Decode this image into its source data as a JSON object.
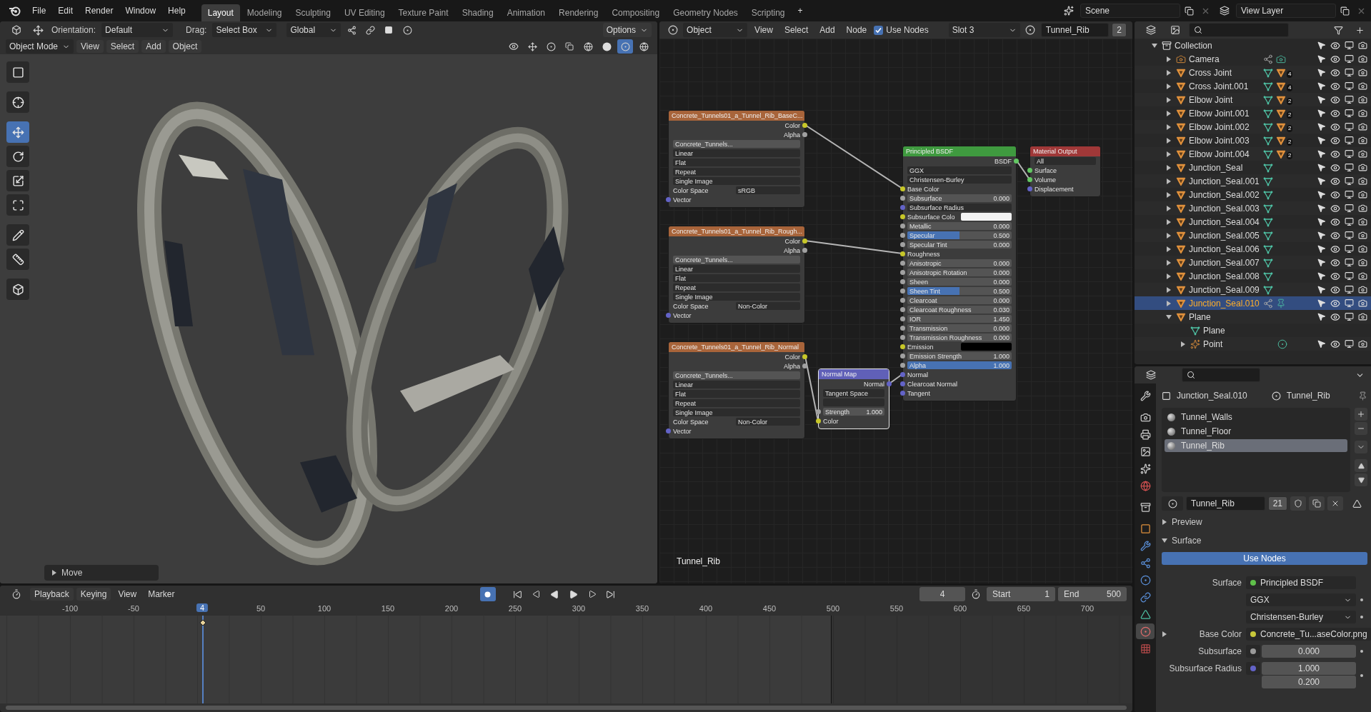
{
  "menu": [
    "File",
    "Edit",
    "Render",
    "Window",
    "Help"
  ],
  "workspaces": [
    {
      "label": "Layout",
      "selected": true
    },
    {
      "label": "Modeling",
      "selected": false
    },
    {
      "label": "Sculpting",
      "selected": false
    },
    {
      "label": "UV Editing",
      "selected": false
    },
    {
      "label": "Texture Paint",
      "selected": false
    },
    {
      "label": "Shading",
      "selected": false
    },
    {
      "label": "Animation",
      "selected": false
    },
    {
      "label": "Rendering",
      "selected": false
    },
    {
      "label": "Compositing",
      "selected": false
    },
    {
      "label": "Geometry Nodes",
      "selected": false
    },
    {
      "label": "Scripting",
      "selected": false
    }
  ],
  "add_workspace": "+",
  "scene": "Scene",
  "view_layer": "View Layer",
  "viewport": {
    "orientation_label": "Orientation:",
    "orientation": "Default",
    "drag_label": "Drag:",
    "drag": "Select Box",
    "transform": "Global",
    "options": "Options",
    "mode": "Object Mode",
    "menus": [
      "View",
      "Select",
      "Add",
      "Object"
    ],
    "tools": [
      {
        "kind": "select",
        "selected": false
      },
      {
        "kind": "cursor",
        "selected": false
      },
      {
        "kind": "move",
        "selected": true
      },
      {
        "kind": "rotate",
        "selected": false
      },
      {
        "kind": "scale",
        "selected": false
      },
      {
        "kind": "transform",
        "selected": false
      },
      {
        "kind": "annotate",
        "selected": false
      },
      {
        "kind": "measure",
        "selected": false
      },
      {
        "kind": "add-cube",
        "selected": false
      }
    ],
    "last_operator": "Move"
  },
  "node_editor": {
    "type": "Object",
    "menus": [
      "View",
      "Select",
      "Add",
      "Node"
    ],
    "use_nodes": {
      "label": "Use Nodes",
      "checked": true
    },
    "slot": "Slot 3",
    "material": "Tunnel_Rib",
    "users": "2",
    "material_label": "Tunnel_Rib",
    "nodes": [
      {
        "title": "Concrete_Tunnels01_a_Tunnel_Rib_BaseC...",
        "outputs": [
          "Color",
          "Alpha"
        ],
        "image": "Concrete_Tunnels...",
        "options": [
          "Linear",
          "Flat",
          "Repeat",
          "Single Image"
        ],
        "color_space_label": "Color Space",
        "color_space": "sRGB",
        "input": "Vector"
      },
      {
        "title": "Concrete_Tunnels01_a_Tunnel_Rib_Rough...",
        "outputs": [
          "Color",
          "Alpha"
        ],
        "image": "Concrete_Tunnels...",
        "options": [
          "Linear",
          "Flat",
          "Repeat",
          "Single Image"
        ],
        "color_space_label": "Color Space",
        "color_space": "Non-Color",
        "input": "Vector"
      },
      {
        "title": "Concrete_Tunnels01_a_Tunnel_Rib_Normal",
        "outputs": [
          "Color",
          "Alpha"
        ],
        "image": "Concrete_Tunnels...",
        "options": [
          "Linear",
          "Flat",
          "Repeat",
          "Single Image"
        ],
        "color_space_label": "Color Space",
        "color_space": "Non-Color",
        "input": "Vector"
      },
      {
        "kind": "normal_map",
        "title": "Normal Map",
        "output": "Normal",
        "space": "Tangent Space",
        "strength_label": "Strength",
        "strength": "1.000",
        "input": "Color"
      },
      {
        "kind": "principled",
        "title": "Principled BSDF",
        "output": "BSDF",
        "dropdowns": [
          "GGX",
          "Christensen-Burley"
        ],
        "inputs": [
          {
            "label": "Base Color",
            "kind": "socket"
          },
          {
            "label": "Subsurface",
            "kind": "value",
            "value": "0.000"
          },
          {
            "label": "Subsurface Radius",
            "kind": "dropdown"
          },
          {
            "label": "Subsurface Colo",
            "kind": "swatch",
            "color": "#f2f2f2"
          },
          {
            "label": "Metallic",
            "kind": "value",
            "value": "0.000"
          },
          {
            "label": "Specular",
            "kind": "slider",
            "value": "0.500",
            "level": 0.5
          },
          {
            "label": "Specular Tint",
            "kind": "value",
            "value": "0.000"
          },
          {
            "label": "Roughness",
            "kind": "socket"
          },
          {
            "label": "Anisotropic",
            "kind": "value",
            "value": "0.000"
          },
          {
            "label": "Anisotropic Rotation",
            "kind": "value",
            "value": "0.000"
          },
          {
            "label": "Sheen",
            "kind": "value",
            "value": "0.000"
          },
          {
            "label": "Sheen Tint",
            "kind": "slider",
            "value": "0.500",
            "level": 0.5
          },
          {
            "label": "Clearcoat",
            "kind": "value",
            "value": "0.000"
          },
          {
            "label": "Clearcoat Roughness",
            "kind": "value",
            "value": "0.030"
          },
          {
            "label": "IOR",
            "kind": "value",
            "value": "1.450"
          },
          {
            "label": "Transmission",
            "kind": "value",
            "value": "0.000"
          },
          {
            "label": "Transmission Roughness",
            "kind": "value",
            "value": "0.000"
          },
          {
            "label": "Emission",
            "kind": "swatch",
            "color": "#000000"
          },
          {
            "label": "Emission Strength",
            "kind": "value",
            "value": "1.000"
          },
          {
            "label": "Alpha",
            "kind": "slider",
            "value": "1.000",
            "level": 1
          },
          {
            "label": "Normal",
            "kind": "vector"
          },
          {
            "label": "Clearcoat Normal",
            "kind": "vector"
          },
          {
            "label": "Tangent",
            "kind": "vector"
          }
        ]
      },
      {
        "kind": "output",
        "title": "Material Output",
        "target": "All",
        "inputs": [
          "Surface",
          "Volume",
          "Displacement"
        ]
      }
    ]
  },
  "outliner": {
    "collection": "Collection",
    "items": [
      {
        "name": "Camera",
        "kind": "camera",
        "expanded": false,
        "selected": false,
        "data_icons": [
          {
            "kind": "relation"
          },
          {
            "kind": "camera-data"
          }
        ]
      },
      {
        "name": "Cross Joint",
        "kind": "mesh",
        "expanded": false,
        "selected": false,
        "data_icons": [
          {
            "kind": "mesh-data"
          },
          {
            "kind": "material",
            "count": "4"
          }
        ]
      },
      {
        "name": "Cross Joint.001",
        "kind": "mesh",
        "expanded": false,
        "selected": false,
        "data_icons": [
          {
            "kind": "mesh-data"
          },
          {
            "kind": "material",
            "count": "4"
          }
        ]
      },
      {
        "name": "Elbow Joint",
        "kind": "mesh",
        "expanded": false,
        "selected": false,
        "data_icons": [
          {
            "kind": "mesh-data"
          },
          {
            "kind": "material",
            "count": "2"
          }
        ]
      },
      {
        "name": "Elbow Joint.001",
        "kind": "mesh",
        "expanded": false,
        "selected": false,
        "data_icons": [
          {
            "kind": "mesh-data"
          },
          {
            "kind": "material",
            "count": "2"
          }
        ]
      },
      {
        "name": "Elbow Joint.002",
        "kind": "mesh",
        "expanded": false,
        "selected": false,
        "data_icons": [
          {
            "kind": "mesh-data"
          },
          {
            "kind": "material",
            "count": "2"
          }
        ]
      },
      {
        "name": "Elbow Joint.003",
        "kind": "mesh",
        "expanded": false,
        "selected": false,
        "data_icons": [
          {
            "kind": "mesh-data"
          },
          {
            "kind": "material",
            "count": "2"
          }
        ]
      },
      {
        "name": "Elbow Joint.004",
        "kind": "mesh",
        "expanded": false,
        "selected": false,
        "data_icons": [
          {
            "kind": "mesh-data"
          },
          {
            "kind": "material",
            "count": "2"
          }
        ]
      },
      {
        "name": "Junction_Seal",
        "kind": "mesh",
        "expanded": false,
        "selected": false,
        "data_icons": [
          {
            "kind": "mesh-data"
          }
        ]
      },
      {
        "name": "Junction_Seal.001",
        "kind": "mesh",
        "expanded": false,
        "selected": false,
        "data_icons": [
          {
            "kind": "mesh-data"
          }
        ]
      },
      {
        "name": "Junction_Seal.002",
        "kind": "mesh",
        "expanded": false,
        "selected": false,
        "data_icons": [
          {
            "kind": "mesh-data"
          }
        ]
      },
      {
        "name": "Junction_Seal.003",
        "kind": "mesh",
        "expanded": false,
        "selected": false,
        "data_icons": [
          {
            "kind": "mesh-data"
          }
        ]
      },
      {
        "name": "Junction_Seal.004",
        "kind": "mesh",
        "expanded": false,
        "selected": false,
        "data_icons": [
          {
            "kind": "mesh-data"
          }
        ]
      },
      {
        "name": "Junction_Seal.005",
        "kind": "mesh",
        "expanded": false,
        "selected": false,
        "data_icons": [
          {
            "kind": "mesh-data"
          }
        ]
      },
      {
        "name": "Junction_Seal.006",
        "kind": "mesh",
        "expanded": false,
        "selected": false,
        "data_icons": [
          {
            "kind": "mesh-data"
          }
        ]
      },
      {
        "name": "Junction_Seal.007",
        "kind": "mesh",
        "expanded": false,
        "selected": false,
        "data_icons": [
          {
            "kind": "mesh-data"
          }
        ]
      },
      {
        "name": "Junction_Seal.008",
        "kind": "mesh",
        "expanded": false,
        "selected": false,
        "data_icons": [
          {
            "kind": "mesh-data"
          }
        ]
      },
      {
        "name": "Junction_Seal.009",
        "kind": "mesh",
        "expanded": false,
        "selected": false,
        "data_icons": [
          {
            "kind": "mesh-data"
          }
        ]
      },
      {
        "name": "Junction_Seal.010",
        "kind": "mesh",
        "expanded": false,
        "selected": true,
        "data_icons": [
          {
            "kind": "relation"
          },
          {
            "kind": "pin"
          }
        ]
      },
      {
        "name": "Plane",
        "kind": "mesh",
        "expanded": true,
        "selected": false,
        "children": [
          {
            "name": "Plane",
            "kind": "mesh-data"
          },
          {
            "name": "Point",
            "kind": "light",
            "expanded": false,
            "selected": false,
            "data_icons": [
              {
                "kind": "light-data"
              }
            ]
          }
        ]
      }
    ]
  },
  "properties": {
    "tabs": [
      {
        "kind": "tool",
        "selected": false
      },
      {
        "kind": "render",
        "selected": false
      },
      {
        "kind": "output",
        "selected": false
      },
      {
        "kind": "view-layer",
        "selected": false
      },
      {
        "kind": "scene",
        "selected": false
      },
      {
        "kind": "world",
        "selected": false
      },
      {
        "kind": "collection",
        "selected": false
      },
      {
        "kind": "object",
        "selected": false
      },
      {
        "kind": "modifiers",
        "selected": false
      },
      {
        "kind": "particles",
        "selected": false
      },
      {
        "kind": "physics",
        "selected": false
      },
      {
        "kind": "constraints",
        "selected": false
      },
      {
        "kind": "data",
        "selected": false
      },
      {
        "kind": "material",
        "selected": true
      },
      {
        "kind": "texture",
        "selected": false
      }
    ],
    "object": "Junction_Seal.010",
    "material": "Tunnel_Rib",
    "slots": [
      {
        "name": "Tunnel_Walls",
        "selected": false
      },
      {
        "name": "Tunnel_Floor",
        "selected": false
      },
      {
        "name": "Tunnel_Rib",
        "selected": true
      }
    ],
    "material_field": "Tunnel_Rib",
    "users": "21",
    "panels": [
      {
        "label": "Preview",
        "expanded": false
      },
      {
        "label": "Surface",
        "expanded": true
      }
    ],
    "use_nodes": "Use Nodes",
    "fields": [
      {
        "kind": "link",
        "label": "Surface",
        "value": "Principled BSDF",
        "color": "#5fc04a"
      },
      {
        "kind": "dropdown",
        "value": "GGX"
      },
      {
        "kind": "dropdown",
        "value": "Christensen-Burley"
      },
      {
        "kind": "link",
        "label": "Base Color",
        "value": "Concrete_Tu...aseColor.png",
        "color": "#c8c83a",
        "expandable": true
      },
      {
        "kind": "number",
        "label": "Subsurface",
        "value": "0.000",
        "color": "#9a9a9a"
      },
      {
        "kind": "vector",
        "label": "Subsurface Radius",
        "values": [
          "1.000",
          "0.200"
        ],
        "color": "#6363c7"
      }
    ]
  },
  "timeline": {
    "menus": [
      "Playback",
      "Keying",
      "View",
      "Marker"
    ],
    "frame": "4",
    "start_label": "Start",
    "start": "1",
    "end_label": "End",
    "end": "500",
    "ticks": [
      "-100",
      "-50",
      "4",
      "50",
      "100",
      "150",
      "200",
      "250",
      "300",
      "350",
      "400",
      "450",
      "500",
      "550",
      "600",
      "650",
      "700"
    ]
  }
}
